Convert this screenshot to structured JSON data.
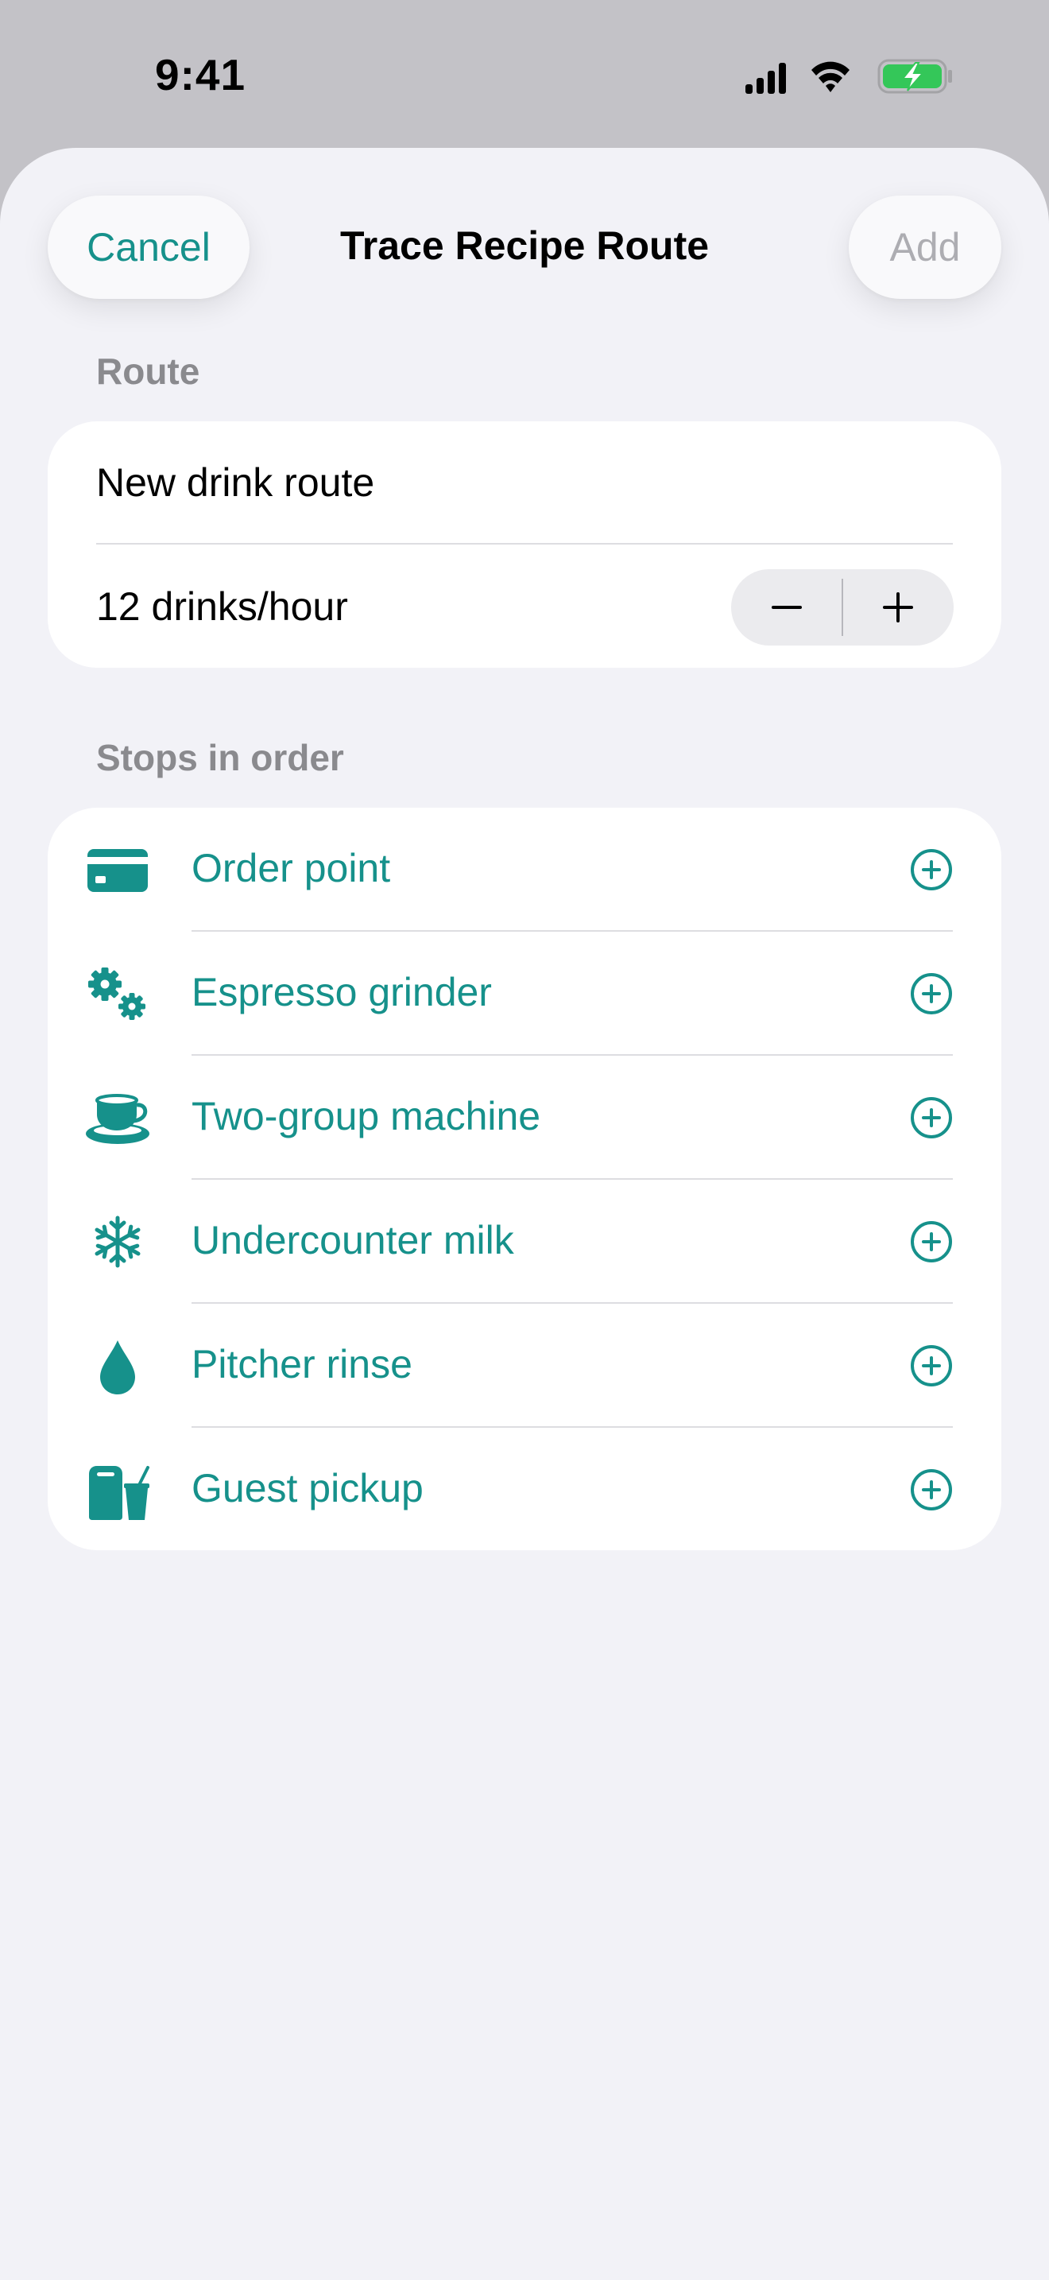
{
  "status_bar": {
    "time": "9:41",
    "icons": [
      "cellular-signal-icon",
      "wifi-icon",
      "battery-charging-icon"
    ]
  },
  "nav": {
    "cancel_label": "Cancel",
    "title": "Trace Recipe Route",
    "add_label": "Add"
  },
  "route_section": {
    "header": "Route",
    "name_value": "New drink route",
    "rate_text": "12 drinks/hour"
  },
  "stops_section": {
    "header": "Stops in order",
    "stops": [
      {
        "label": "Order point",
        "icon": "credit-card-icon"
      },
      {
        "label": "Espresso grinder",
        "icon": "gears-icon"
      },
      {
        "label": "Two-group machine",
        "icon": "cup-and-saucer-icon"
      },
      {
        "label": "Undercounter milk",
        "icon": "snowflake-icon"
      },
      {
        "label": "Pitcher rinse",
        "icon": "drop-icon"
      },
      {
        "label": "Guest pickup",
        "icon": "takeout-bag-cup-icon"
      }
    ]
  },
  "colors": {
    "accent": "#16918b",
    "battery": "#34c759",
    "background": "#f2f2f7",
    "disabled": "#adadb2",
    "section_header": "#8a8a8e"
  }
}
